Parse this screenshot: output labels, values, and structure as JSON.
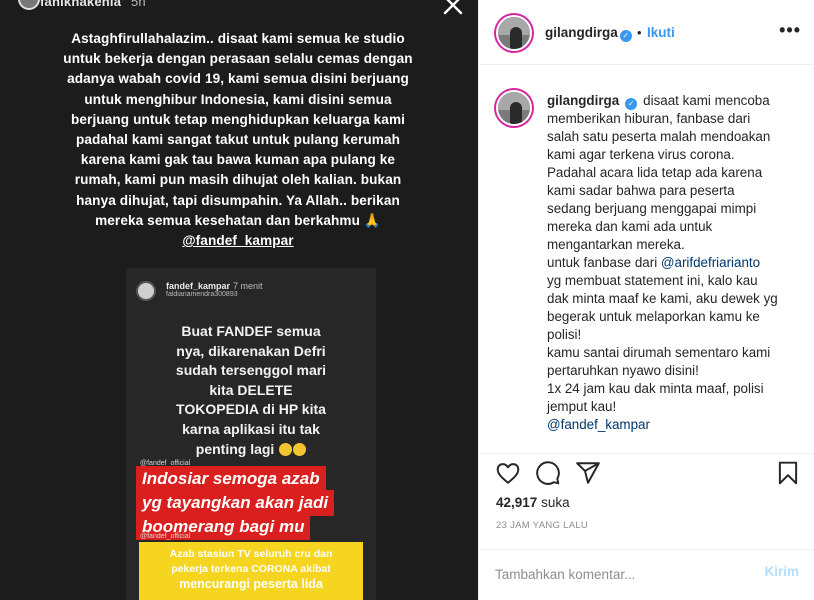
{
  "story": {
    "username": "fanikhakenia",
    "time": "5h",
    "text_lines": [
      "Astaghfirullahalazim.. disaat kami semua ke studio",
      "untuk bekerja dengan perasaan selalu cemas dengan",
      "adanya wabah covid 19, kami semua disini berjuang",
      "untuk menghibur Indonesia, kami disini semua",
      "berjuang untuk tetap menghidupkan keluarga kami",
      "padahal kami sangat takut untuk pulang kerumah",
      "karena kami gak tau bawa kuman apa pulang ke",
      "rumah, kami pun masih dihujat oleh kalian. bukan",
      "hanya dihujat, tapi disumpahin. Ya Allah.. berikan",
      "mereka semua kesehatan dan berkahmu 🙏"
    ],
    "mention": "@fandef_kampar",
    "inner": {
      "username": "fandef_kampar",
      "time": "7 menit",
      "sub": "faldianamendra300893",
      "text_lines": [
        "Buat FANDEF semua",
        "nya, dikarenakan Defri",
        "sudah tersenggol mari",
        "kita DELETE",
        "TOKOPEDIA di HP kita",
        "karna aplikasi itu tak",
        "penting lagi"
      ],
      "credit_top": "@fandef_official",
      "red_lines": [
        "Indosiar semoga azab",
        "yg tayangkan akan jadi",
        "boomerang bagi mu"
      ],
      "credit_mid": "@fandef_official",
      "yellow_lines": [
        "Azab stasiun TV seluruh cru dan",
        "pekerja terkena CORONA  akibat",
        "mencurangi peserta lida"
      ],
      "colors": {
        "red": "#d9201e",
        "yellow": "#f5d51f"
      }
    }
  },
  "post": {
    "username": "gilangdirga",
    "follow_label": "Ikuti",
    "dot": "•",
    "more_icon": "more-options-icon",
    "caption_lines": [
      "disaat kami mencoba",
      "memberikan hiburan, fanbase dari",
      "salah satu peserta malah mendoakan",
      "kami agar terkena virus corona.",
      "Padahal acara lida tetap ada karena",
      "kami sadar bahwa para peserta",
      "sedang berjuang menggapai mimpi",
      "mereka dan kami ada untuk",
      "mengantarkan mereka."
    ],
    "caption_fanbase_prefix": "untuk fanbase dari ",
    "caption_link1": "@arifdefriarianto",
    "caption_lines2": [
      "yg membuat statement ini, kalo kau",
      "dak minta maaf ke kami, aku dewek yg",
      "begerak untuk melaporkan kamu ke",
      "polisi!",
      "kamu santai dirumah sementaro kami",
      "pertaruhkan nyawo disini!",
      "1x 24 jam kau dak minta maaf, polisi",
      "jemput kau!"
    ],
    "caption_link2": "@fandef_kampar",
    "likes": "42,917",
    "likes_suffix": "suka",
    "time_ago": "23 JAM YANG LALU",
    "comment_placeholder": "Tambahkan komentar...",
    "send_label": "Kirim",
    "colors": {
      "link": "#00376b",
      "follow": "#3897f0",
      "send_disabled": "#b2dffc",
      "verified": "#3897f0"
    }
  }
}
